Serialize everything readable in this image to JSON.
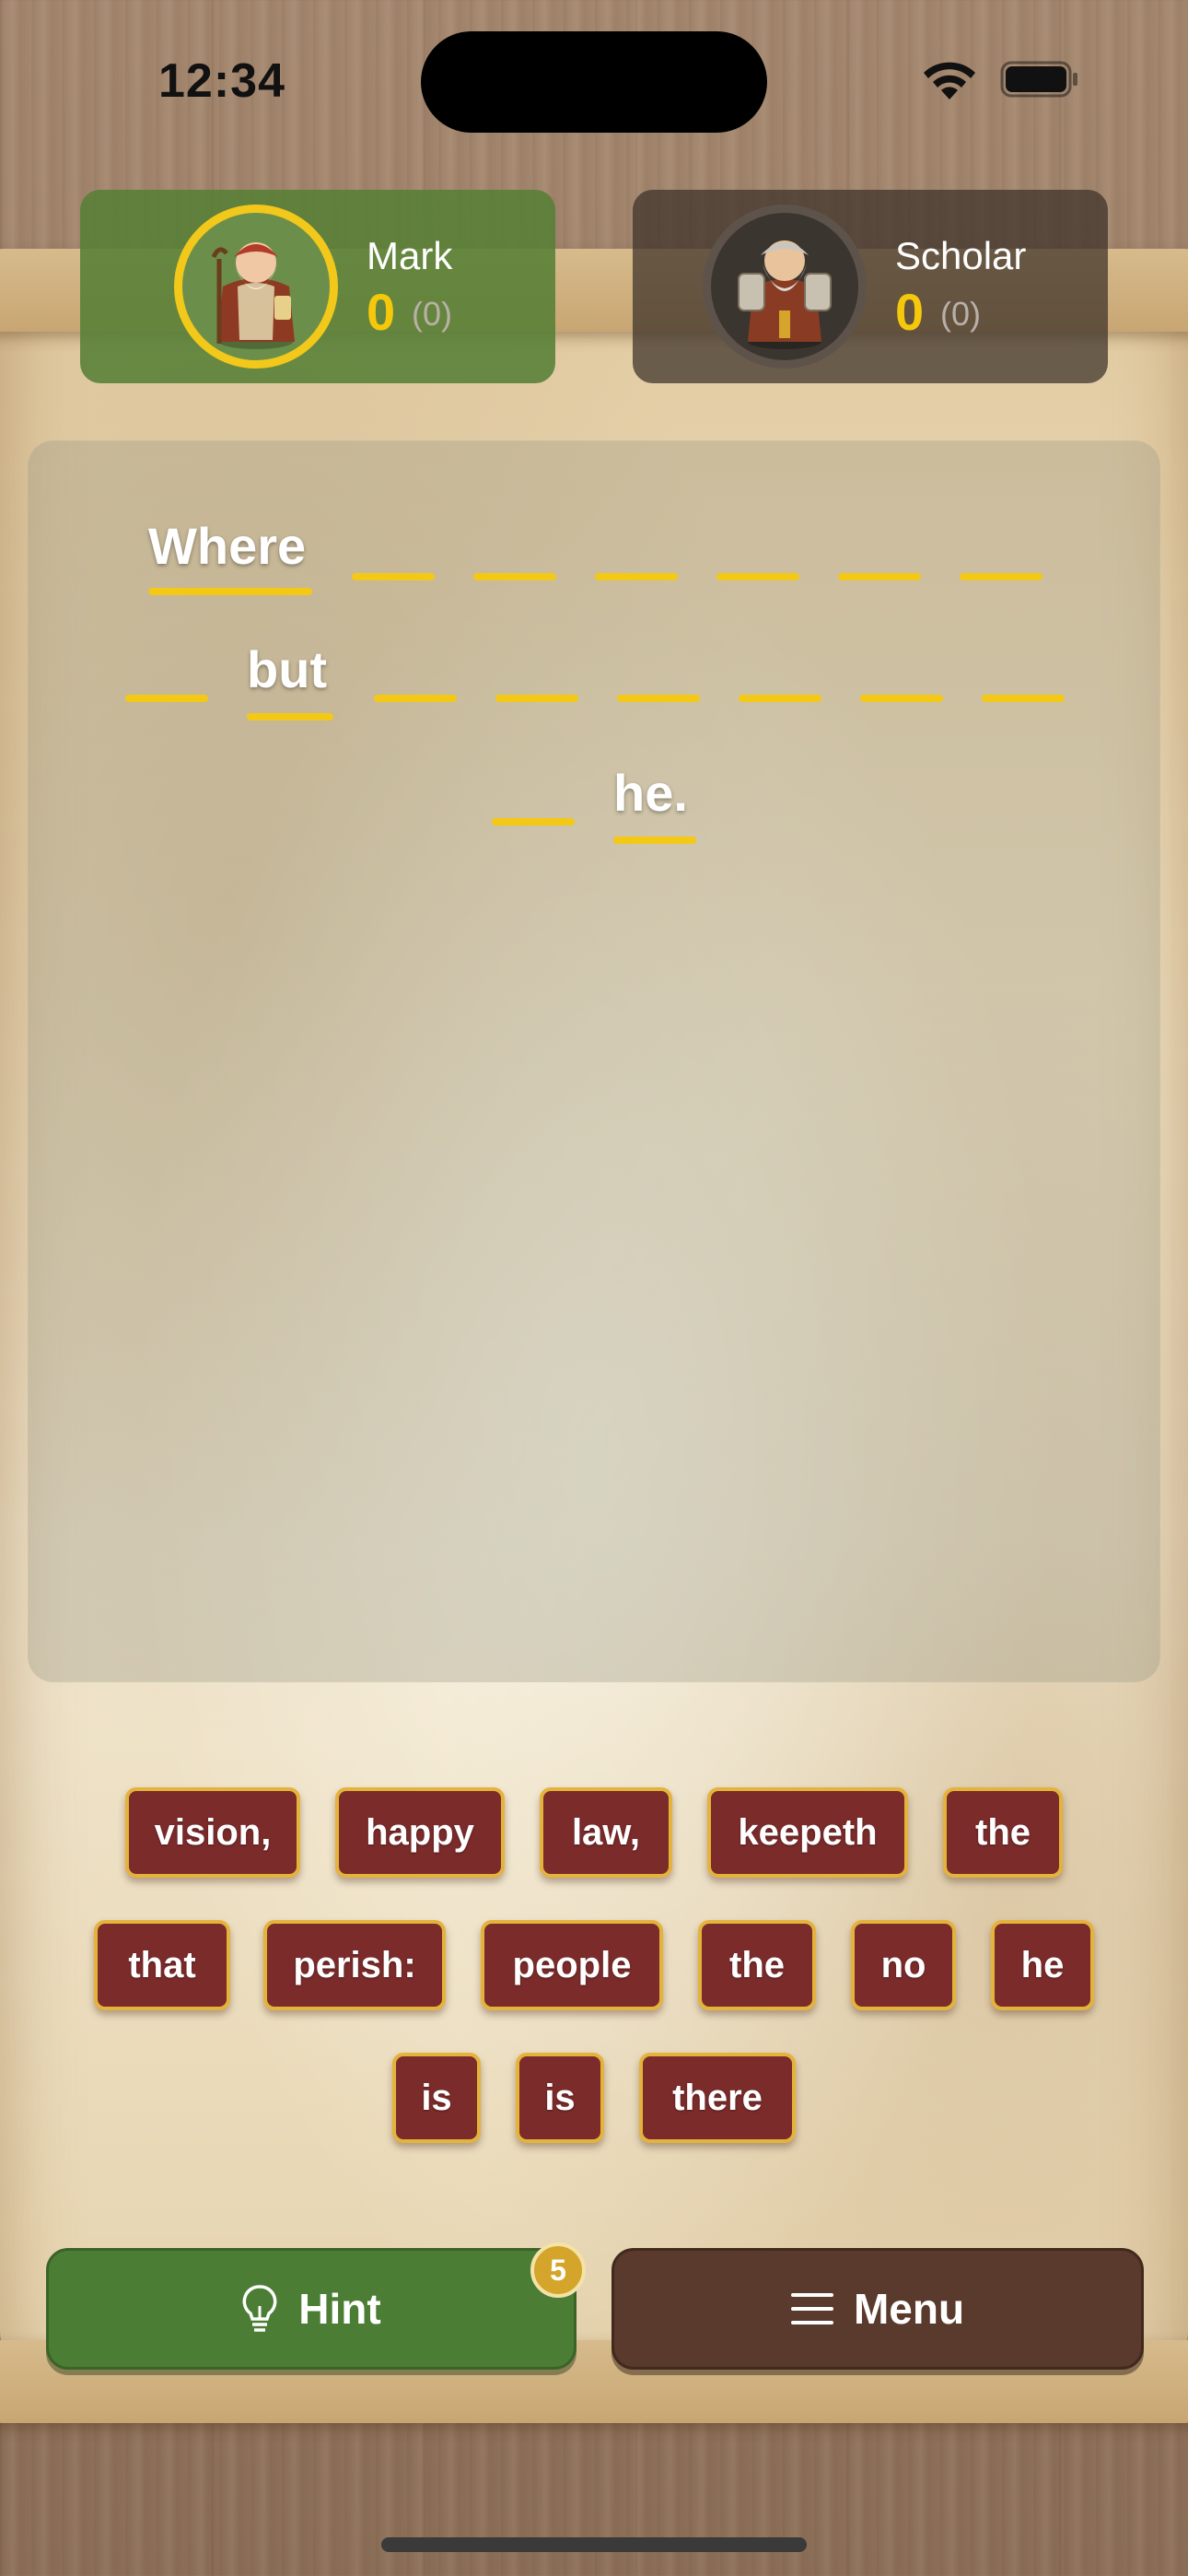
{
  "status_bar": {
    "time": "12:34"
  },
  "players": {
    "mark": {
      "name": "Mark",
      "score": "0",
      "sub": "(0)"
    },
    "scholar": {
      "name": "Scholar",
      "score": "0",
      "sub": "(0)"
    }
  },
  "puzzle": {
    "revealed_words": [
      "Where",
      "but",
      "he."
    ],
    "blank_count": 15
  },
  "tiles": [
    "vision,",
    "happy",
    "law,",
    "keepeth",
    "the",
    "that",
    "perish:",
    "people",
    "the",
    "no",
    "he",
    "is",
    "is",
    "there"
  ],
  "buttons": {
    "hint_label": "Hint",
    "hint_count": "5",
    "menu_label": "Menu"
  },
  "colors": {
    "accent_gold": "#f3c916",
    "tile_bg": "#7a2b2a",
    "hint_green": "#4c7d35",
    "menu_brown": "#593a2c"
  },
  "icons": {
    "hint": "lightbulb-icon",
    "menu": "hamburger-icon"
  }
}
